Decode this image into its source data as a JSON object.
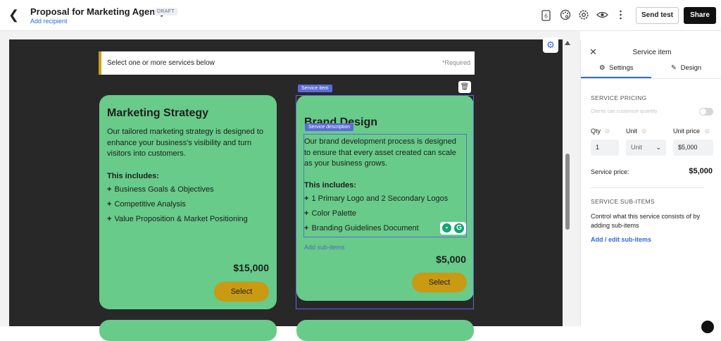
{
  "header": {
    "title": "Proposal for Marketing Agency",
    "draft_badge": "DRAFT",
    "add_recipient": "Add recipient",
    "send_test": "Send test",
    "share": "Share"
  },
  "canvas": {
    "select_prompt": "Select one or more services below",
    "required": "*Required",
    "service_item_tag": "Service item",
    "service_description_tag": "Service description",
    "add_sub_items": "Add sub-items",
    "cards": [
      {
        "title": "Marketing Strategy",
        "description": "Our tailored marketing strategy is designed to enhance your business's visibility and turn visitors into customers.",
        "includes_label": "This includes:",
        "items": [
          "Business Goals & Objectives",
          "Competitive Analysis",
          "Value Proposition & Market Positioning"
        ],
        "price": "$15,000",
        "button": "Select"
      },
      {
        "title": "Brand Design",
        "description": "Our brand development process is designed to ensure that every asset created can scale as your business grows.",
        "includes_label": "This includes:",
        "items": [
          "1 Primary Logo and 2 Secondary Logos",
          "Color Palette",
          "Branding Guidelines Document"
        ],
        "price": "$5,000",
        "button": "Select"
      }
    ],
    "plus_glyph": "+"
  },
  "panel": {
    "title": "Service item",
    "tabs": [
      "Settings",
      "Design"
    ],
    "pricing_heading": "SERVICE PRICING",
    "customize_label": "Clients can customize quantity",
    "qty_label": "Qty",
    "unit_label": "Unit",
    "unit_price_label": "Unit price",
    "qty_value": "1",
    "unit_value": "Unit",
    "unit_price_value": "$5,000",
    "service_price_label": "Service price:",
    "service_price_value": "$5,000",
    "subitems_heading": "SERVICE SUB-ITEMS",
    "subitems_text": "Control what this service consists of by adding sub-items",
    "subitems_link": "Add / edit sub-items"
  },
  "colors": {
    "card": "#68cb89",
    "button": "#c99a12",
    "accent": "#2f6ad9",
    "selection": "#5b6bd6"
  }
}
